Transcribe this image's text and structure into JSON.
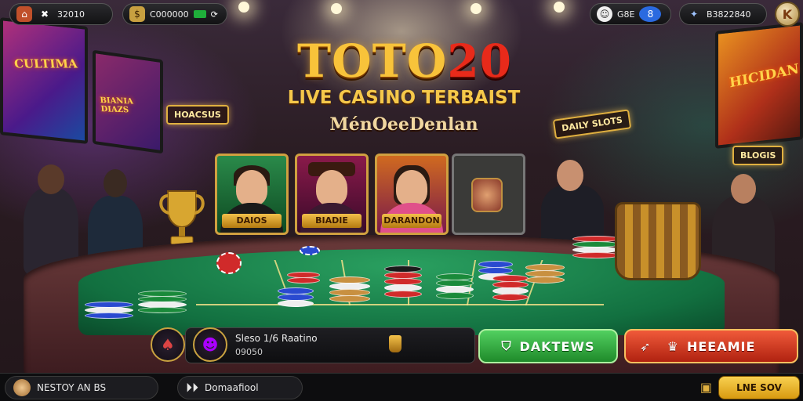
{
  "hud": {
    "home_icon": "home-icon",
    "stat1_value": "32010",
    "stat2_value": "C000000",
    "stat3_label": "G8E",
    "stat3_badge": "8",
    "stat4_value": "B3822840",
    "profile_icon": "k-icon"
  },
  "hero": {
    "title_main": "TOTO",
    "title_num": "20",
    "subtitle": "LIVE CASINO TERBAIST",
    "tagline": "MénOeeDenlan"
  },
  "cards": [
    {
      "label": "DAIOS"
    },
    {
      "label": "BIADIE"
    },
    {
      "label": "DARANDON"
    },
    {
      "label": ""
    }
  ],
  "signs": {
    "left_screen": "CULTIMA",
    "left_screen2": "BIANIA DIAZS",
    "neon_left": "HOACSUS",
    "neon_right": "DAILY SLOTS",
    "right_screen": "HICIDAN",
    "right_screen2": "BLOGIS"
  },
  "action": {
    "live_title": "Sleso 1/6 Raatino",
    "live_sub": "09050",
    "green_button": "DAKTEWS",
    "red_button": "HEEAMIE"
  },
  "footer": {
    "left_label": "NESTOY AN BS",
    "mid_label": "Domaafiool",
    "live_button": "LNE SOV"
  },
  "colors": {
    "accent_gold": "#f8c33a",
    "accent_red": "#e82a1a",
    "felt_green": "#1a8a4a",
    "button_green": "#1f8a2a",
    "button_red": "#b02210"
  }
}
